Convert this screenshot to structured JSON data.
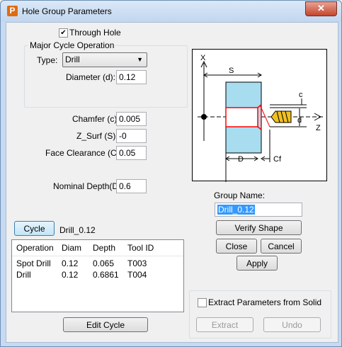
{
  "window": {
    "title": "Hole Group Parameters",
    "app_icon": "P",
    "close_glyph": "✕"
  },
  "through_hole": {
    "label": "Through Hole",
    "checked": true
  },
  "major_cycle": {
    "group_label": "Major Cycle  Operation",
    "type_label": "Type:",
    "type_value": "Drill",
    "diameter_label": "Diameter (d):",
    "diameter_value": "0.12"
  },
  "params": {
    "chamfer_label": "Chamfer (c):",
    "chamfer_value": "0.005",
    "zsurf_label": "Z_Surf (S):",
    "zsurf_value": "-0",
    "face_clearance_label": "Face Clearance (Cf):",
    "face_clearance_value": "0.05",
    "nominal_depth_label": "Nominal Depth(D):",
    "nominal_depth_value": "0.6"
  },
  "diagram": {
    "x_label": "X",
    "z_label": "Z",
    "s_label": "S",
    "c_label": "c",
    "d_label": "d",
    "D_label": "D",
    "cf_label": "Cf"
  },
  "group_name": {
    "label": "Group Name:",
    "value": "Drill_0.12"
  },
  "buttons": {
    "verify_shape": "Verify Shape",
    "close": "Close",
    "cancel": "Cancel",
    "apply": "Apply",
    "cycle": "Cycle",
    "edit_cycle": "Edit Cycle",
    "extract": "Extract",
    "undo": "Undo"
  },
  "cycle_name": "Drill_0.12",
  "table": {
    "headers": [
      "Operation",
      "Diam",
      "Depth",
      "Tool ID"
    ],
    "rows": [
      [
        "Spot Drill",
        "0.12",
        "0.065",
        "T003"
      ],
      [
        "Drill",
        "0.12",
        "0.6861",
        "T004"
      ]
    ]
  },
  "extract": {
    "label": "Extract Parameters from Solid",
    "checked": false
  }
}
